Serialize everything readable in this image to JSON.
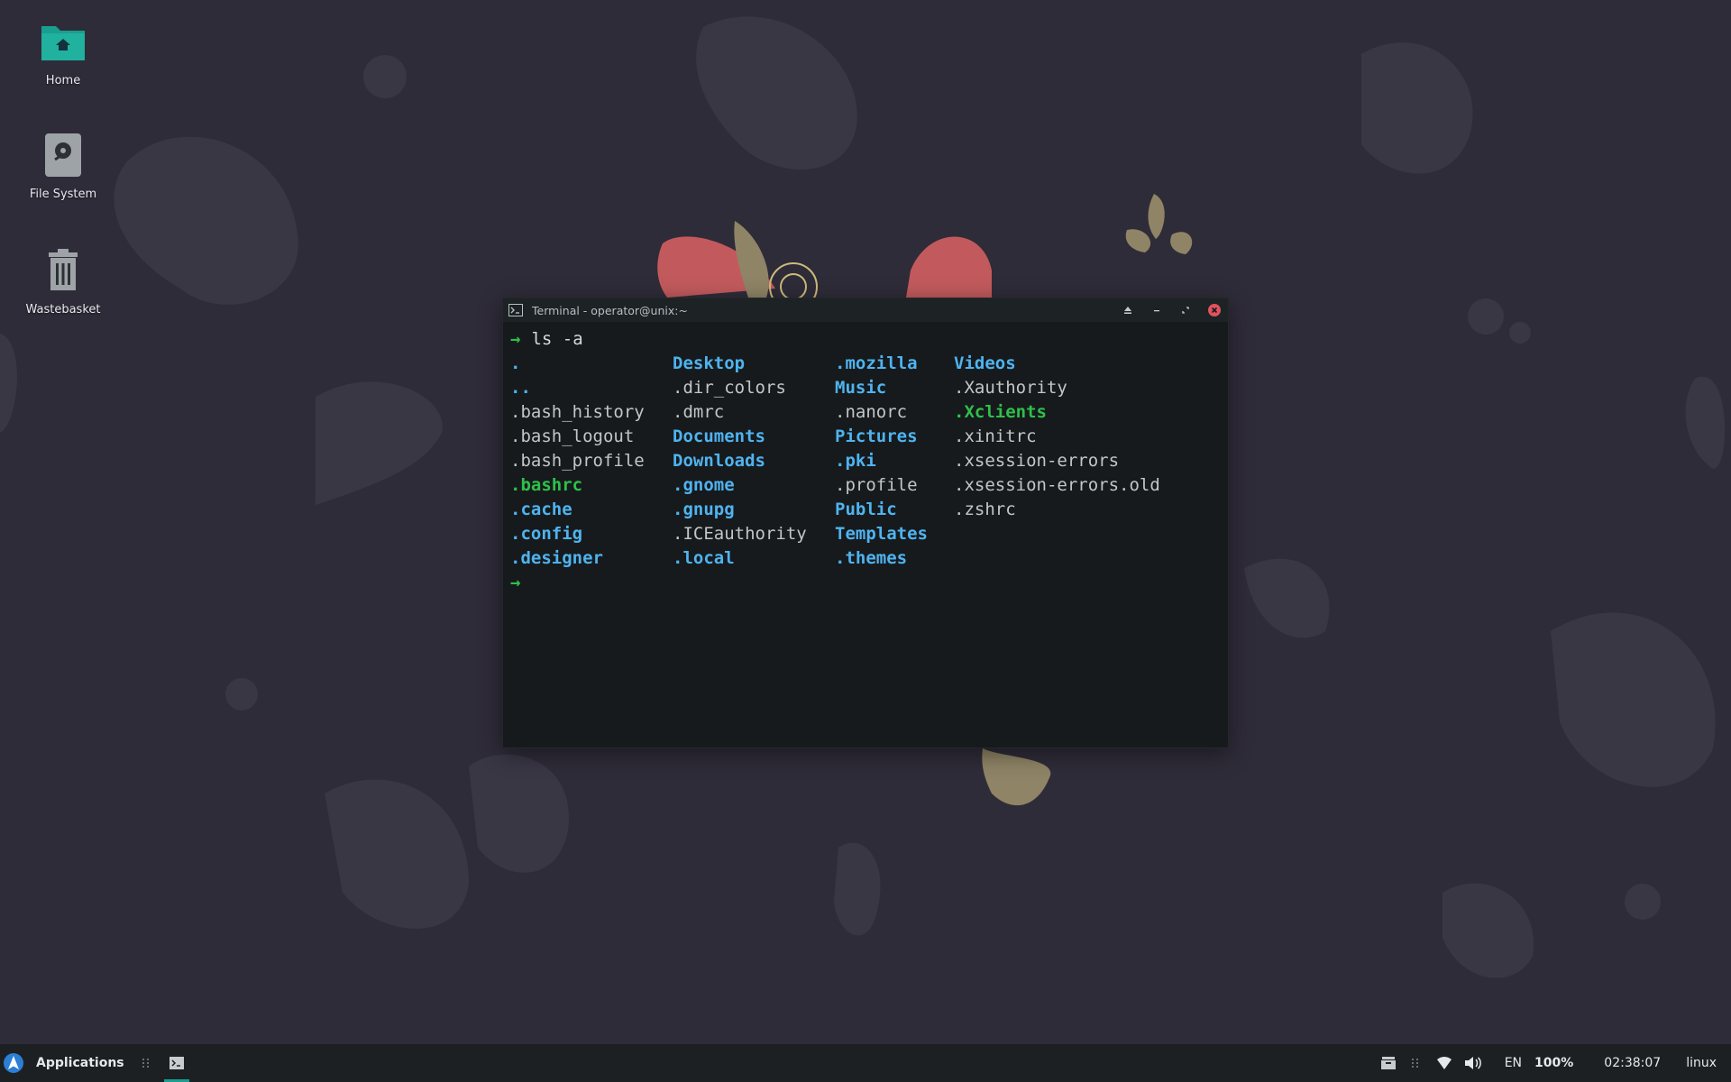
{
  "desktop": {
    "icons": [
      {
        "label": "Home",
        "icon": "home-folder-icon"
      },
      {
        "label": "File System",
        "icon": "drive-icon"
      },
      {
        "label": "Wastebasket",
        "icon": "trash-icon"
      }
    ]
  },
  "terminal": {
    "title": "Terminal - operator@unix:~",
    "prompt_symbol": "→",
    "command": "ls -a",
    "listing": [
      [
        {
          "name": ".",
          "kind": "dir"
        },
        {
          "name": "..",
          "kind": "dir"
        },
        {
          "name": ".bash_history",
          "kind": "plain"
        },
        {
          "name": ".bash_logout",
          "kind": "plain"
        },
        {
          "name": ".bash_profile",
          "kind": "plain"
        },
        {
          "name": ".bashrc",
          "kind": "exec"
        },
        {
          "name": ".cache",
          "kind": "dir"
        },
        {
          "name": ".config",
          "kind": "dir"
        },
        {
          "name": ".designer",
          "kind": "dir"
        }
      ],
      [
        {
          "name": "Desktop",
          "kind": "dir"
        },
        {
          "name": ".dir_colors",
          "kind": "plain"
        },
        {
          "name": ".dmrc",
          "kind": "plain"
        },
        {
          "name": "Documents",
          "kind": "dir"
        },
        {
          "name": "Downloads",
          "kind": "dir"
        },
        {
          "name": ".gnome",
          "kind": "dir"
        },
        {
          "name": ".gnupg",
          "kind": "dir"
        },
        {
          "name": ".ICEauthority",
          "kind": "plain"
        },
        {
          "name": ".local",
          "kind": "dir"
        }
      ],
      [
        {
          "name": ".mozilla",
          "kind": "dir"
        },
        {
          "name": "Music",
          "kind": "dir"
        },
        {
          "name": ".nanorc",
          "kind": "plain"
        },
        {
          "name": "Pictures",
          "kind": "dir"
        },
        {
          "name": ".pki",
          "kind": "dir"
        },
        {
          "name": ".profile",
          "kind": "plain"
        },
        {
          "name": "Public",
          "kind": "dir"
        },
        {
          "name": "Templates",
          "kind": "dir"
        },
        {
          "name": ".themes",
          "kind": "dir"
        }
      ],
      [
        {
          "name": "Videos",
          "kind": "dir"
        },
        {
          "name": ".Xauthority",
          "kind": "plain"
        },
        {
          "name": ".Xclients",
          "kind": "exec"
        },
        {
          "name": ".xinitrc",
          "kind": "plain"
        },
        {
          "name": ".xsession-errors",
          "kind": "plain"
        },
        {
          "name": ".xsession-errors.old",
          "kind": "plain"
        },
        {
          "name": ".zshrc",
          "kind": "plain"
        }
      ]
    ]
  },
  "taskbar": {
    "menu_label": "Applications",
    "tray": {
      "keyboard_layout": "EN",
      "volume": "100%",
      "clock": "02:38:07",
      "user": "linux"
    }
  },
  "colors": {
    "desktop_bg": "#2f2c39",
    "terminal_bg": "#161a1c",
    "dir": "#4fb3f0",
    "exec": "#2fbf4a",
    "close_button": "#e0525e",
    "taskbar_bg": "#1c2022",
    "accent": "#1a9e8f"
  }
}
